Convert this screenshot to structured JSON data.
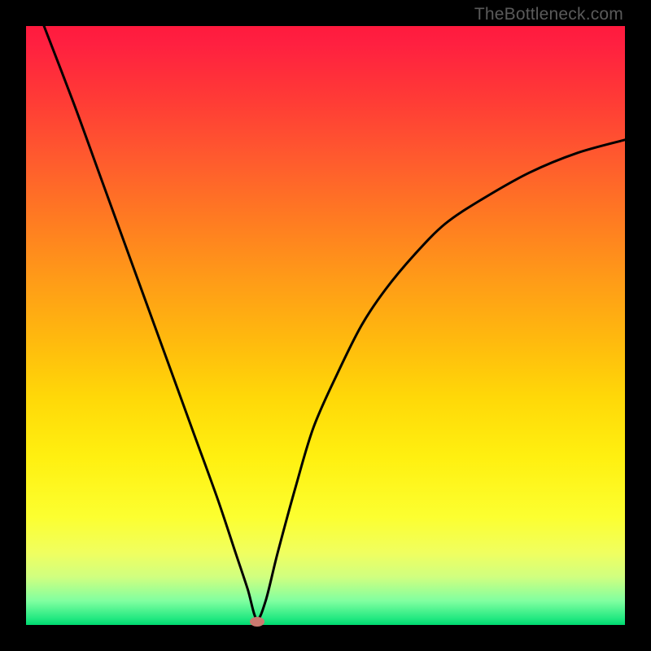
{
  "watermark": "TheBottleneck.com",
  "chart_data": {
    "type": "line",
    "title": "",
    "xlabel": "",
    "ylabel": "",
    "xlim": [
      0,
      100
    ],
    "ylim": [
      0,
      100
    ],
    "grid": false,
    "legend": false,
    "background_gradient": {
      "orientation": "vertical",
      "stops": [
        {
          "pos": 0.0,
          "color": "#ff1a3e"
        },
        {
          "pos": 0.5,
          "color": "#ffb80e"
        },
        {
          "pos": 0.82,
          "color": "#fcff30"
        },
        {
          "pos": 0.96,
          "color": "#80ffa0"
        },
        {
          "pos": 1.0,
          "color": "#00d870"
        }
      ]
    },
    "series": [
      {
        "name": "bottleneck-curve",
        "color": "#000000",
        "x": [
          3,
          8,
          12,
          16,
          20,
          24,
          28,
          32,
          35,
          37,
          38.5,
          40,
          42,
          45,
          48,
          52,
          56,
          60,
          65,
          70,
          76,
          84,
          92,
          100
        ],
        "y": [
          100,
          87,
          76,
          65,
          54,
          43,
          32,
          21,
          12,
          6,
          1,
          4,
          12,
          23,
          33,
          42,
          50,
          56,
          62,
          67,
          71,
          75.5,
          78.8,
          81
        ]
      }
    ],
    "marker": {
      "name": "optimal-point",
      "x": 38.6,
      "y": 0.6,
      "color": "#cb7a70",
      "shape": "ellipse"
    }
  }
}
